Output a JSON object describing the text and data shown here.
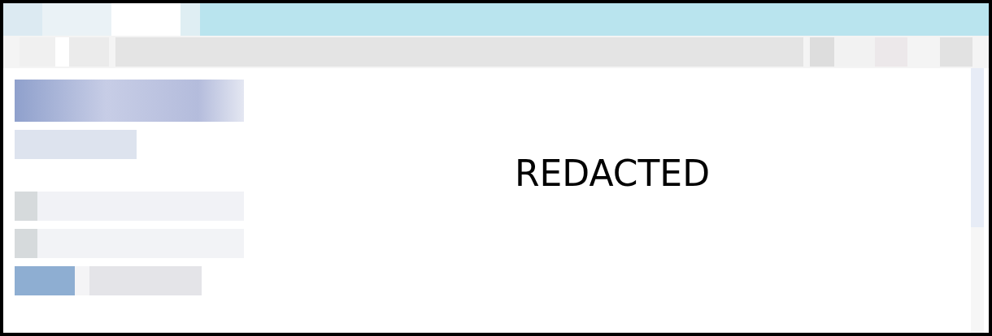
{
  "redaction_label": "REDACTED"
}
